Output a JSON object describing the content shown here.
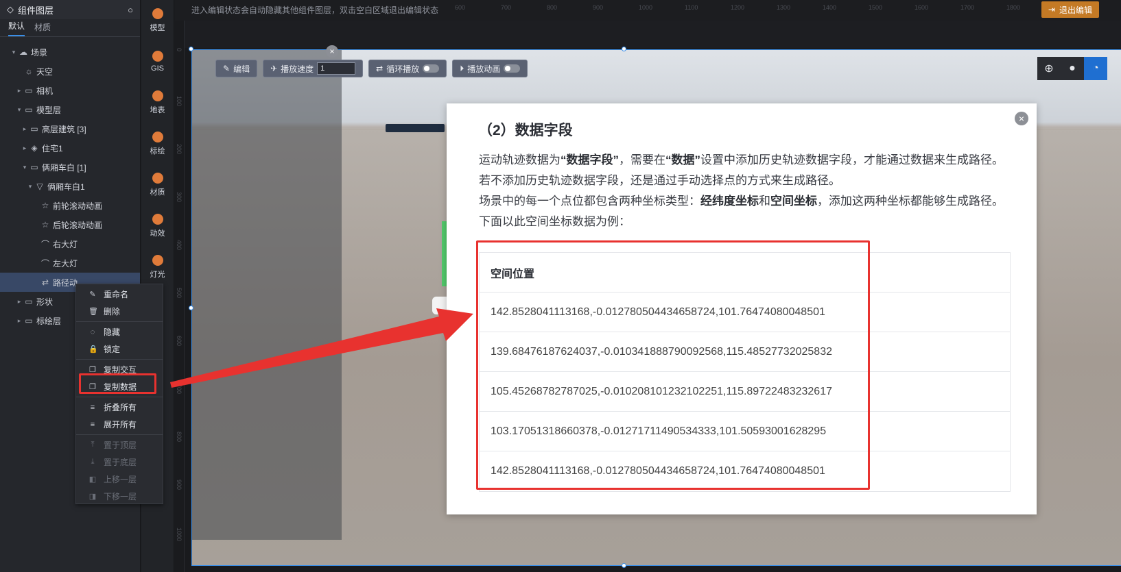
{
  "layer_panel": {
    "title": "组件图层",
    "tabs": [
      "默认",
      "材质"
    ],
    "tree": [
      {
        "label": "场景",
        "caret": "▾",
        "icon": "☁",
        "indent": 0
      },
      {
        "label": "天空",
        "caret": "",
        "icon": "☼",
        "indent": 1
      },
      {
        "label": "相机",
        "caret": "▸",
        "icon": "▭",
        "indent": 1
      },
      {
        "label": "模型层",
        "caret": "▾",
        "icon": "▭",
        "indent": 1
      },
      {
        "label": "高层建筑 [3]",
        "caret": "▸",
        "icon": "▭",
        "indent": 2
      },
      {
        "label": "住宅1",
        "caret": "▸",
        "icon": "◈",
        "indent": 2
      },
      {
        "label": "俩厢车白 [1]",
        "caret": "▾",
        "icon": "▭",
        "indent": 2
      },
      {
        "label": "俩厢车白1",
        "caret": "▾",
        "icon": "▽",
        "indent": 3
      },
      {
        "label": "前轮滚动动画",
        "caret": "",
        "icon": "☆",
        "indent": 4
      },
      {
        "label": "后轮滚动动画",
        "caret": "",
        "icon": "☆",
        "indent": 4
      },
      {
        "label": "右大灯",
        "caret": "",
        "icon": "⌒",
        "indent": 4
      },
      {
        "label": "左大灯",
        "caret": "",
        "icon": "⌒",
        "indent": 4
      },
      {
        "label": "路径动",
        "caret": "",
        "icon": "⇄",
        "indent": 4
      },
      {
        "label": "形状",
        "caret": "▸",
        "icon": "▭",
        "indent": 1
      },
      {
        "label": "标绘层",
        "caret": "▸",
        "icon": "▭",
        "indent": 1
      }
    ]
  },
  "tools": [
    {
      "label": "模型",
      "color": "#e07b3a"
    },
    {
      "label": "GIS",
      "color": "#e07b3a"
    },
    {
      "label": "地表",
      "color": "#e07b3a"
    },
    {
      "label": "标绘",
      "color": "#e07b3a"
    },
    {
      "label": "材质",
      "color": "#e07b3a"
    },
    {
      "label": "动效",
      "color": "#e07b3a"
    },
    {
      "label": "灯光",
      "color": "#e07b3a"
    }
  ],
  "topbar": {
    "hint": "进入编辑状态会自动隐藏其他组件图层，双击空白区域退出编辑状态",
    "exit_label": "退出编辑",
    "ruler_labels": [
      "600",
      "700",
      "800",
      "900",
      "1000",
      "1100",
      "1200",
      "1300",
      "1400",
      "1500",
      "1600",
      "1700",
      "1800"
    ]
  },
  "vruler_labels": [
    "0",
    "100",
    "200",
    "300",
    "400",
    "500",
    "600",
    "700",
    "800",
    "900",
    "1000"
  ],
  "scene_toolbar": {
    "edit_label": "编辑",
    "speed_label": "播放速度",
    "speed_value": "1",
    "loop_label": "循环播放",
    "anim_label": "播放动画"
  },
  "modal": {
    "title": "（2）数据字段",
    "p1_a": "运动轨迹数据为",
    "p1_b": "“数据字段”",
    "p1_c": "，需要在",
    "p1_d": "“数据”",
    "p1_e": "设置中添加历史轨迹数据字段，才能通过数据来生成路径。若不添加历史轨迹数据字段，还是通过手动选择点的方式来生成路径。",
    "p2_a": "场景中的每一个点位都包含两种坐标类型：",
    "p2_b": "经纬度坐标",
    "p2_c": "和",
    "p2_d": "空间坐标",
    "p2_e": "，添加这两种坐标都能够生成路径。下面以此空间坐标数据为例：",
    "table_header": "空间位置",
    "rows": [
      "142.8528041113168,-0.012780504434658724,101.76474080048501",
      "139.68476187624037,-0.010341888790092568,115.48527732025832",
      "105.45268782787025,-0.010208101232102251,115.89722483232617",
      "103.17051318660378,-0.01271711490534333,101.50593001628295",
      "142.8528041113168,-0.012780504434658724,101.76474080048501"
    ]
  },
  "context_menu": {
    "groups": [
      [
        {
          "label": "重命名",
          "icon": "✎",
          "disabled": false
        },
        {
          "label": "删除",
          "icon": "🗑",
          "disabled": false
        }
      ],
      [
        {
          "label": "隐藏",
          "icon": "◌",
          "disabled": false
        },
        {
          "label": "锁定",
          "icon": "🔒",
          "disabled": false
        }
      ],
      [
        {
          "label": "复制交互",
          "icon": "❐",
          "disabled": false
        },
        {
          "label": "复制数据",
          "icon": "❐",
          "disabled": false
        }
      ],
      [
        {
          "label": "折叠所有",
          "icon": "≡",
          "disabled": false
        },
        {
          "label": "展开所有",
          "icon": "≡",
          "disabled": false
        }
      ],
      [
        {
          "label": "置于顶层",
          "icon": "⤒",
          "disabled": true
        },
        {
          "label": "置于底层",
          "icon": "⤓",
          "disabled": true
        },
        {
          "label": "上移一层",
          "icon": "◧",
          "disabled": true
        },
        {
          "label": "下移一层",
          "icon": "◨",
          "disabled": true
        }
      ]
    ]
  },
  "colors": {
    "accent": "#3a8ee6",
    "highlight_red": "#e8322f",
    "exit_orange": "#c47a25"
  }
}
